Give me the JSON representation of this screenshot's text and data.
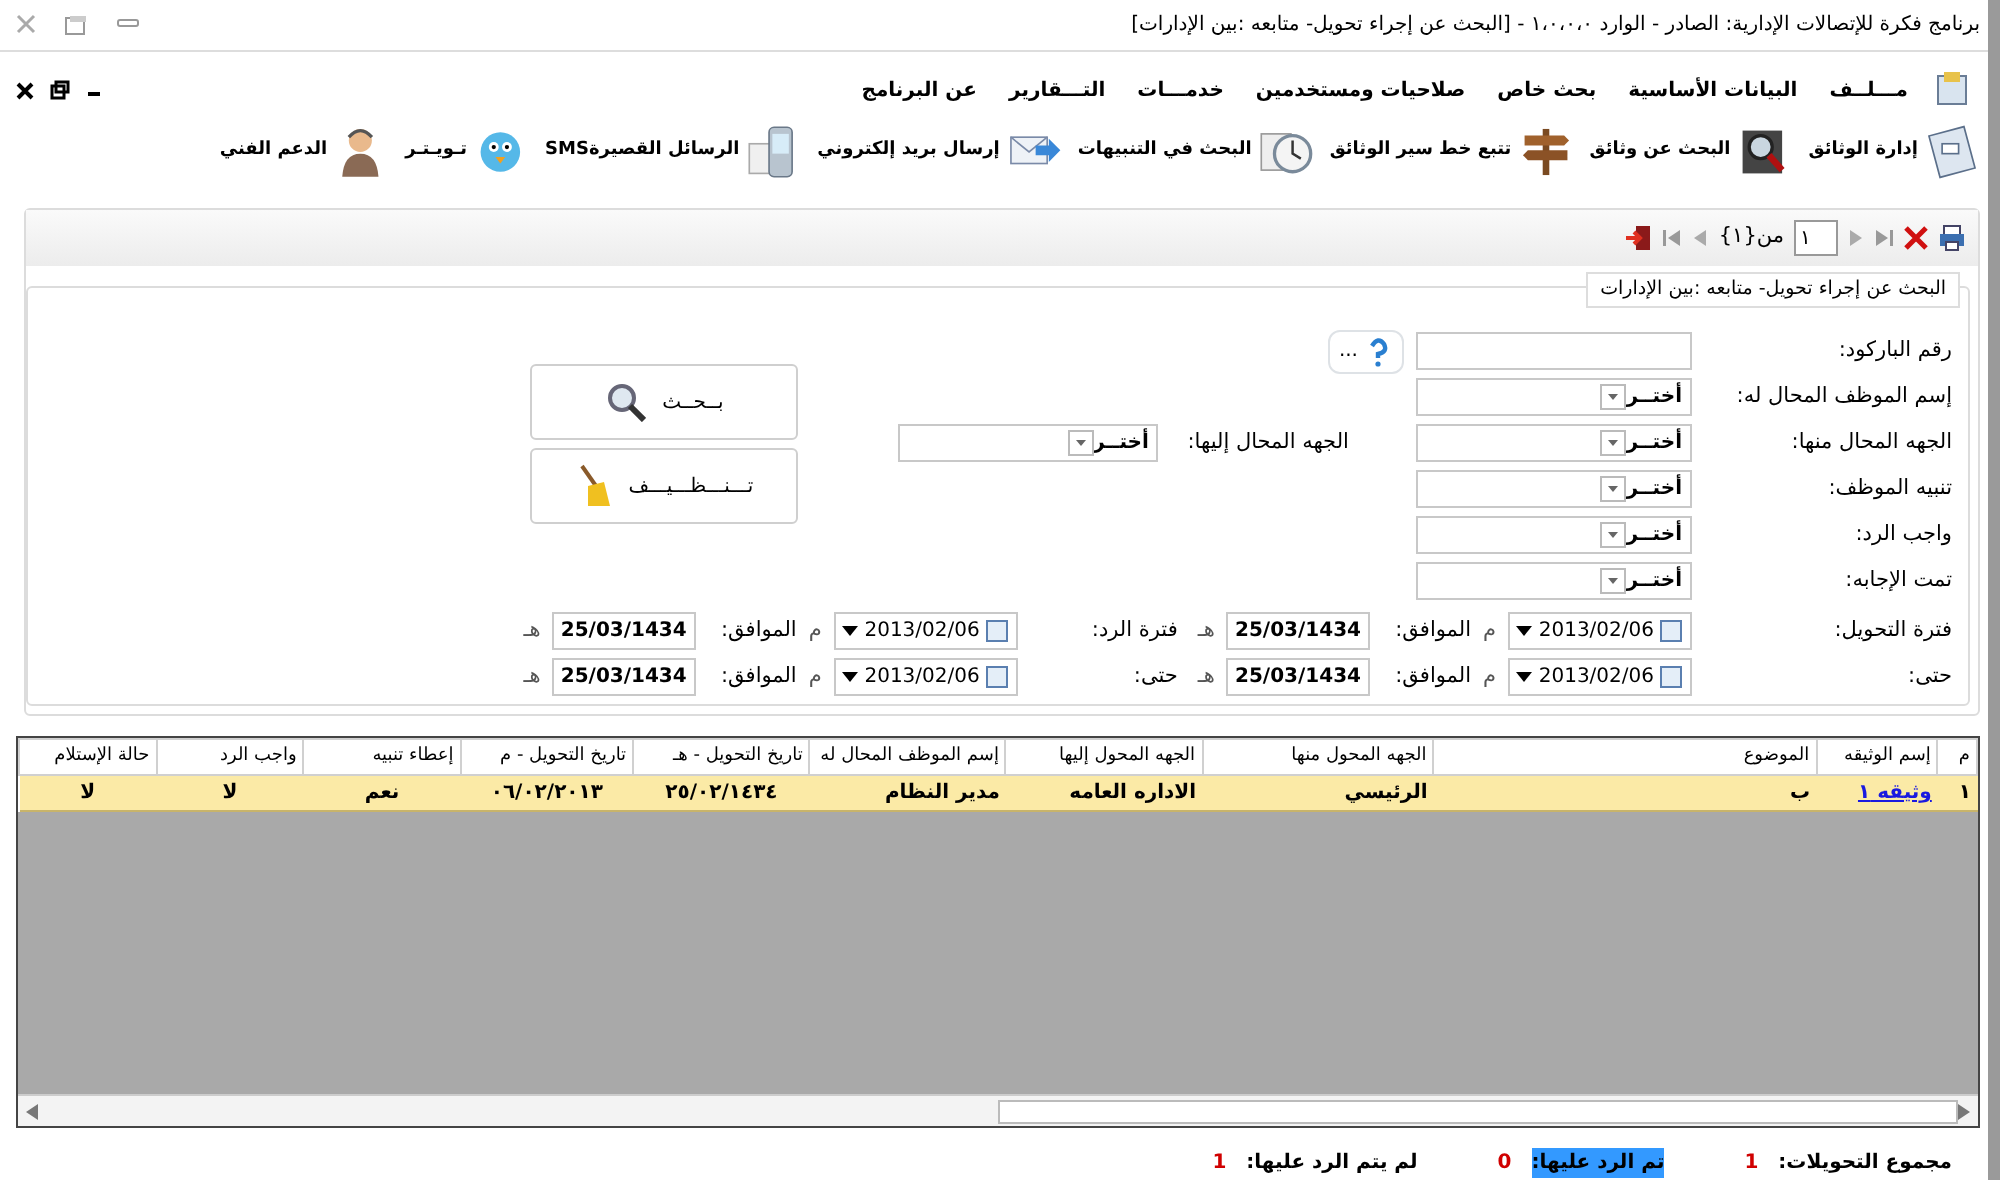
{
  "window": {
    "title": "برنامج فكرة للإتصالات الإدارية: الصادر - الوارد  ١،٠،٠،٠ - [البحث عن إجراء تحويل- متابعه :بين الإدارات]"
  },
  "menu": [
    {
      "label": "مـــلــف"
    },
    {
      "label": "البيانات الأساسية"
    },
    {
      "label": "بحث خاص"
    },
    {
      "label": "صلاحيات ومستخدمين"
    },
    {
      "label": "خدمـــات"
    },
    {
      "label": "التـــقارير"
    },
    {
      "label": "عن البرنامج"
    }
  ],
  "toolbar": [
    {
      "label": "إدارة الوثائق",
      "kind": "documents"
    },
    {
      "label": "البحث عن وثائق",
      "kind": "search"
    },
    {
      "label": "تتبع خط سير الوثائق",
      "kind": "signpost"
    },
    {
      "label": "البحث في التنبيهات",
      "kind": "clock"
    },
    {
      "label": "إرسال بريد إلكتروني",
      "kind": "mail"
    },
    {
      "label": "الرسائل القصيرةSMS",
      "kind": "phone"
    },
    {
      "label": "تـويـتـر",
      "kind": "bird"
    },
    {
      "label": "الدعم الفني",
      "kind": "support"
    }
  ],
  "pager": {
    "page": "١",
    "of_text": "من{١}"
  },
  "form": {
    "title": "البحث عن إجراء تحويل- متابعه :بين الإدارات",
    "barcode": {
      "label": "رقم الباركود:",
      "button": "..."
    },
    "combos": [
      {
        "label": "إسم الموظف المحال له:",
        "value": "أختــر"
      },
      {
        "label": "الجهه المحال منها:",
        "value": "أختــر"
      },
      {
        "label": "تنبيه الموظف:",
        "value": "أختــر"
      },
      {
        "label": "واجب الرد:",
        "value": "أختــر"
      },
      {
        "label": "تمت الإجابه:",
        "value": "أختــر"
      }
    ],
    "target_combo": {
      "label": "الجهه المحال إليها:",
      "value": "أختــر"
    },
    "date_rows": [
      {
        "groups": [
          {
            "label": "فترة التحويل:",
            "date": "2013/02/06",
            "m": "م",
            "agree": "الموافق:",
            "hijri": "25/03/1434",
            "h": "هـ"
          },
          {
            "label": "فترة الرد:",
            "date": "2013/02/06",
            "m": "م",
            "agree": "الموافق:",
            "hijri": "25/03/1434",
            "h": "هـ"
          }
        ]
      },
      {
        "groups": [
          {
            "label": "حتى:",
            "date": "2013/02/06",
            "m": "م",
            "agree": "الموافق:",
            "hijri": "25/03/1434",
            "h": "هـ"
          },
          {
            "label": "حتى:",
            "date": "2013/02/06",
            "m": "م",
            "agree": "الموافق:",
            "hijri": "25/03/1434",
            "h": "هـ"
          }
        ]
      }
    ],
    "search_button": "بــحــث",
    "clear_button": "تـــنـــظـــيـــف"
  },
  "table": {
    "columns": [
      "م",
      "إسم الوثيقه",
      "الموضوع",
      "الجهه المحول منها",
      "الجهه المحول إليها",
      "إسم الموظف المحال له",
      "تاريخ التحويل - هـ",
      "تاريخ التحويل - م",
      "إعطاء تنبيه",
      "واجب الرد",
      "حالة الإستلام"
    ],
    "rows": [
      {
        "selected": true,
        "cells": [
          "١",
          "وثيقه ١",
          "ب",
          "الرئيسي",
          "الاداره العامه",
          "مدير النظام",
          "٢٥/٠٢/١٤٣٤",
          "٠٦/٠٢/٢٠١٣",
          "نعم",
          "لا",
          "لا"
        ]
      }
    ]
  },
  "summary": [
    {
      "label": "مجموع التحويلات:",
      "value": "1",
      "selected": false
    },
    {
      "label": "تم الرد عليها:",
      "value": "0",
      "selected": true
    },
    {
      "label": "لم يتم الرد عليها:",
      "value": "1",
      "selected": false
    }
  ]
}
